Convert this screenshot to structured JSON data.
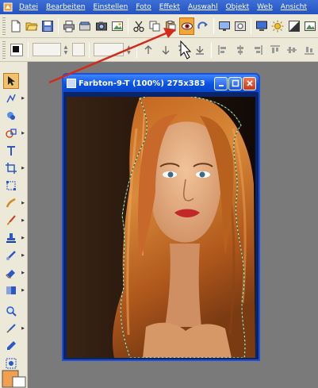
{
  "menu": {
    "items": [
      "Datei",
      "Bearbeiten",
      "Einstellen",
      "Foto",
      "Effekt",
      "Auswahl",
      "Objekt",
      "Web",
      "Ansicht"
    ]
  },
  "document": {
    "title": "Farbton-9-T (100%) 275x383"
  },
  "icons": {
    "app": "app-logo-icon",
    "highlighted_tool": "red-eye-tool-icon"
  },
  "colors": {
    "menubar": "#2453c2",
    "toolbar": "#ece9d8",
    "workspace": "#7a7a7a",
    "titlebar": "#0a52e0",
    "highlight": "#f4a53a",
    "annotation_arrow": "#d42a1a"
  }
}
